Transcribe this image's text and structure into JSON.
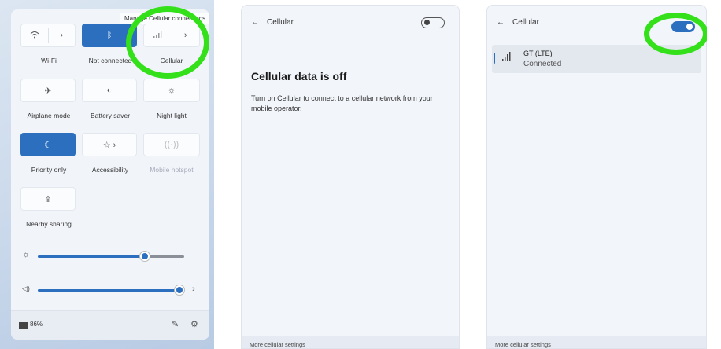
{
  "quick_settings": {
    "tooltip": "Manage Cellular connections",
    "tiles": [
      {
        "label": "Wi-Fi",
        "state": "off"
      },
      {
        "label": "Not connected",
        "state": "on"
      },
      {
        "label": "Cellular",
        "state": "off"
      },
      {
        "label": "Airplane mode",
        "state": "off"
      },
      {
        "label": "Battery saver",
        "state": "off"
      },
      {
        "label": "Night light",
        "state": "off"
      },
      {
        "label": "Priority only",
        "state": "on"
      },
      {
        "label": "Accessibility",
        "state": "off"
      },
      {
        "label": "Mobile hotspot",
        "state": "disabled"
      },
      {
        "label": "Nearby sharing",
        "state": "off"
      }
    ],
    "brightness_level": 0.73,
    "volume_level": 0.96,
    "battery": "86%",
    "accent_color": "#2c6fbf"
  },
  "cellular_off": {
    "title": "Cellular",
    "heading": "Cellular data is off",
    "body": "Turn on Cellular to connect to a cellular network from your mobile operator.",
    "footer": "More cellular settings",
    "toggle": "off"
  },
  "cellular_on": {
    "title": "Cellular",
    "network_name": "GT (LTE)",
    "network_status": "Connected",
    "footer": "More cellular settings",
    "toggle": "on"
  },
  "highlight_color": "#33e01a"
}
